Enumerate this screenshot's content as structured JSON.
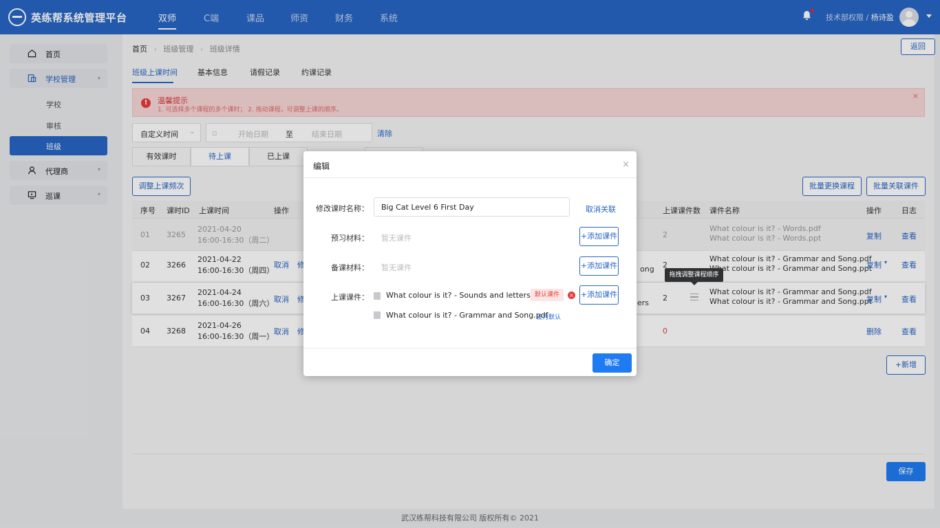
{
  "app": {
    "brand": "英练帮系统管理平台"
  },
  "topnav": {
    "items": [
      "双师",
      "C端",
      "课品",
      "师资",
      "财务",
      "系统"
    ],
    "active": "双师"
  },
  "user": {
    "dept": "技术部权限",
    "sep": "/",
    "name": "杨诗盈"
  },
  "sidebar": {
    "home": "首页",
    "school_mgmt": "学校管理",
    "subitems": [
      "学校",
      "审核",
      "班级"
    ],
    "agent": "代理商",
    "patrol": "巡课"
  },
  "breadcrumb": [
    "首页",
    "班级管理",
    "班级详情"
  ],
  "back_label": "返回",
  "tabs": [
    "班级上课时间",
    "基本信息",
    "请假记录",
    "约课记录"
  ],
  "alert": {
    "title": "温馨提示",
    "text": "1. 可选择多个课程的多个课时；   2. 拖动课程，可调整上课的顺序。",
    "close": "×"
  },
  "filter": {
    "time_type": "自定义时间",
    "start_placeholder": "开始日期",
    "to": "至",
    "end_placeholder": "结束日期",
    "clear": "清除"
  },
  "status_tabs": [
    "有效课时",
    "待上课",
    "已上课"
  ],
  "buttons": {
    "adjust": "调整上课频次",
    "batch_replace": "批量更换课程",
    "batch_link": "批量关联课件",
    "add": "+新增",
    "save": "保存"
  },
  "table": {
    "headers": [
      "序号",
      "课时ID",
      "上课时间",
      "操作",
      "上课课件数",
      "课件名称",
      "操作",
      "日志"
    ],
    "rows": [
      {
        "no": "01",
        "id": "3265",
        "date": "2021-04-20",
        "time": "16:00-16:30（周二）",
        "ops": [
          "",
          ""
        ],
        "name_tail": "",
        "count": "2",
        "files": [
          "What colour is it? - Words.pdf",
          "What colour is it? - Words.ppt"
        ],
        "action": "复制",
        "log": "查看"
      },
      {
        "no": "02",
        "id": "3266",
        "date": "2021-04-22",
        "time": "16:00-16:30（周四）",
        "ops": [
          "取消",
          "修"
        ],
        "name_tail": "ong",
        "count": "2",
        "files": [
          "What colour is it? - Grammar and Song.pdf",
          "What colour is it? - Grammar and Song.ppt"
        ],
        "action": "复制",
        "log": "查看"
      },
      {
        "no": "03",
        "id": "3267",
        "date": "2021-04-24",
        "time": "16:00-16:30（周六）",
        "ops": [
          "取消",
          "修"
        ],
        "name_tail": "ers",
        "count": "2",
        "files": [
          "What colour is it? - Grammar and Song.pdf",
          "What colour is it? - Grammar and Song.ppt"
        ],
        "action": "复制",
        "log": "查看"
      },
      {
        "no": "04",
        "id": "3268",
        "date": "2021-04-26",
        "time": "16:00-16:30（周一）",
        "ops": [
          "取消",
          "修"
        ],
        "name_tail": "",
        "count": "0",
        "files": [
          "",
          ""
        ],
        "action": "删除",
        "log": "查看"
      }
    ]
  },
  "tooltip": "拖拽调整课程顺序",
  "modal": {
    "title": "编辑",
    "close": "×",
    "name_label": "修改课时名称：",
    "name_value": "Big Cat Level 6 First Day",
    "unlink": "取消关联",
    "preview_label": "预习材料：",
    "prep_label": "备课材料：",
    "class_label": "上课课件：",
    "empty": "暂无课件",
    "add_courseware": "+添加课件",
    "files": [
      "What colour is it? - Sounds and letters.pptx",
      "What colour is it? - Grammar and Song.pdf"
    ],
    "default_tag": "默认课件",
    "set_default": "设为默认",
    "ok": "确定"
  },
  "footer": "武汉练帮科技有限公司 版权所有© 2021",
  "colors": {
    "primary": "#2766c5",
    "danger": "#e83c3c",
    "ok_button": "#1f7bf2"
  }
}
